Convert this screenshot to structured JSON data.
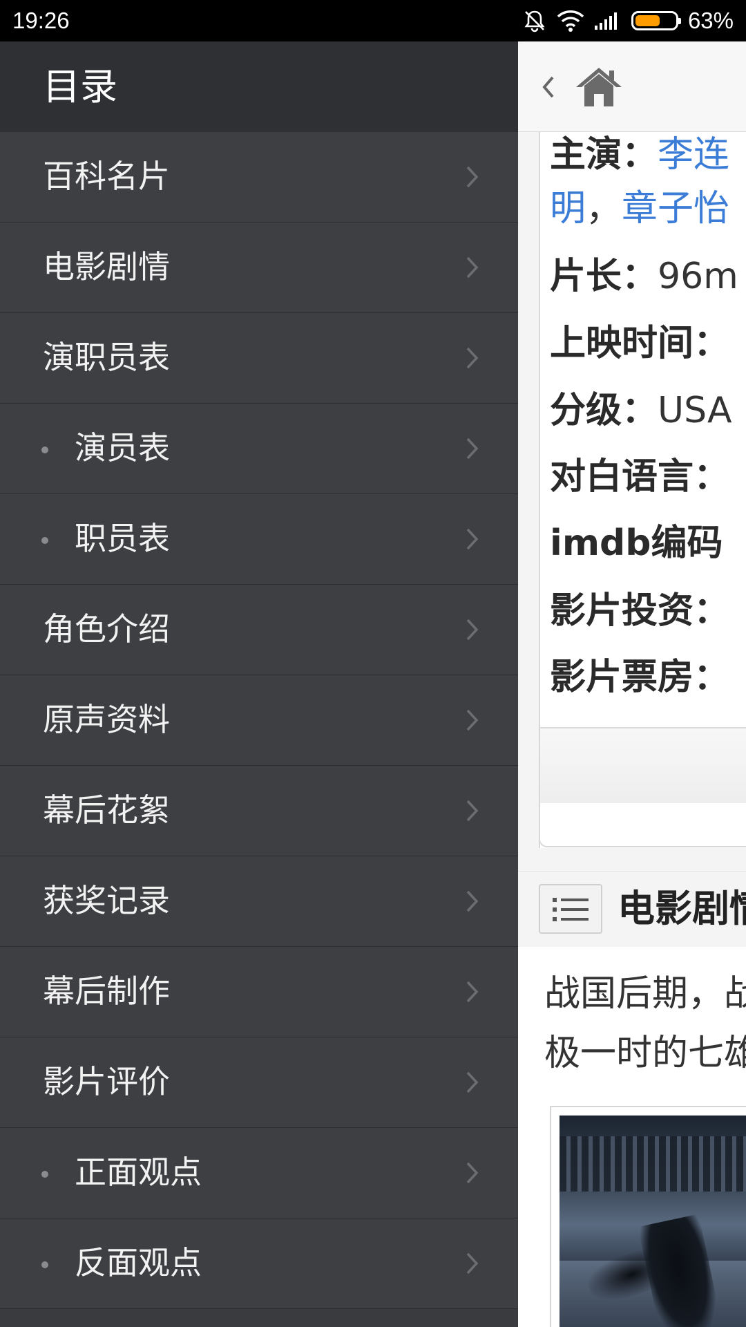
{
  "status_bar": {
    "time": "19:26",
    "battery_percent": "63%",
    "battery_level": 0.63,
    "icons": [
      "mute-icon",
      "wifi-icon",
      "signal-icon",
      "battery-icon"
    ]
  },
  "drawer": {
    "title": "目录",
    "items": [
      {
        "label": "百科名片",
        "sub": false
      },
      {
        "label": "电影剧情",
        "sub": false
      },
      {
        "label": "演职员表",
        "sub": false
      },
      {
        "label": "演员表",
        "sub": true
      },
      {
        "label": "职员表",
        "sub": true
      },
      {
        "label": "角色介绍",
        "sub": false
      },
      {
        "label": "原声资料",
        "sub": false
      },
      {
        "label": "幕后花絮",
        "sub": false
      },
      {
        "label": "获奖记录",
        "sub": false
      },
      {
        "label": "幕后制作",
        "sub": false
      },
      {
        "label": "影片评价",
        "sub": false
      },
      {
        "label": "正面观点",
        "sub": true
      },
      {
        "label": "反面观点",
        "sub": true
      }
    ]
  },
  "content": {
    "info": {
      "starring_key": "主演：",
      "starring_link1": "李连",
      "starring_line2_link": "明",
      "starring_sep": "，",
      "starring_link2": "章子怡",
      "length_key": "片长：",
      "length_value": "96m",
      "release_key": "上映时间：",
      "rating_key": "分级：",
      "rating_value": "USA",
      "language_key": "对白语言：",
      "imdb_key": "imdb编码",
      "investment_key": "影片投资：",
      "boxoffice_key": "影片票房："
    },
    "section": {
      "title": "电影剧情"
    },
    "body_lines": [
      "战国后期，战",
      "极一时的七雄"
    ]
  },
  "colors": {
    "drawer_bg": "#3e3f43",
    "drawer_header_bg": "#2f3033",
    "link": "#3b7cd6",
    "battery_fill": "#ff9c00"
  }
}
